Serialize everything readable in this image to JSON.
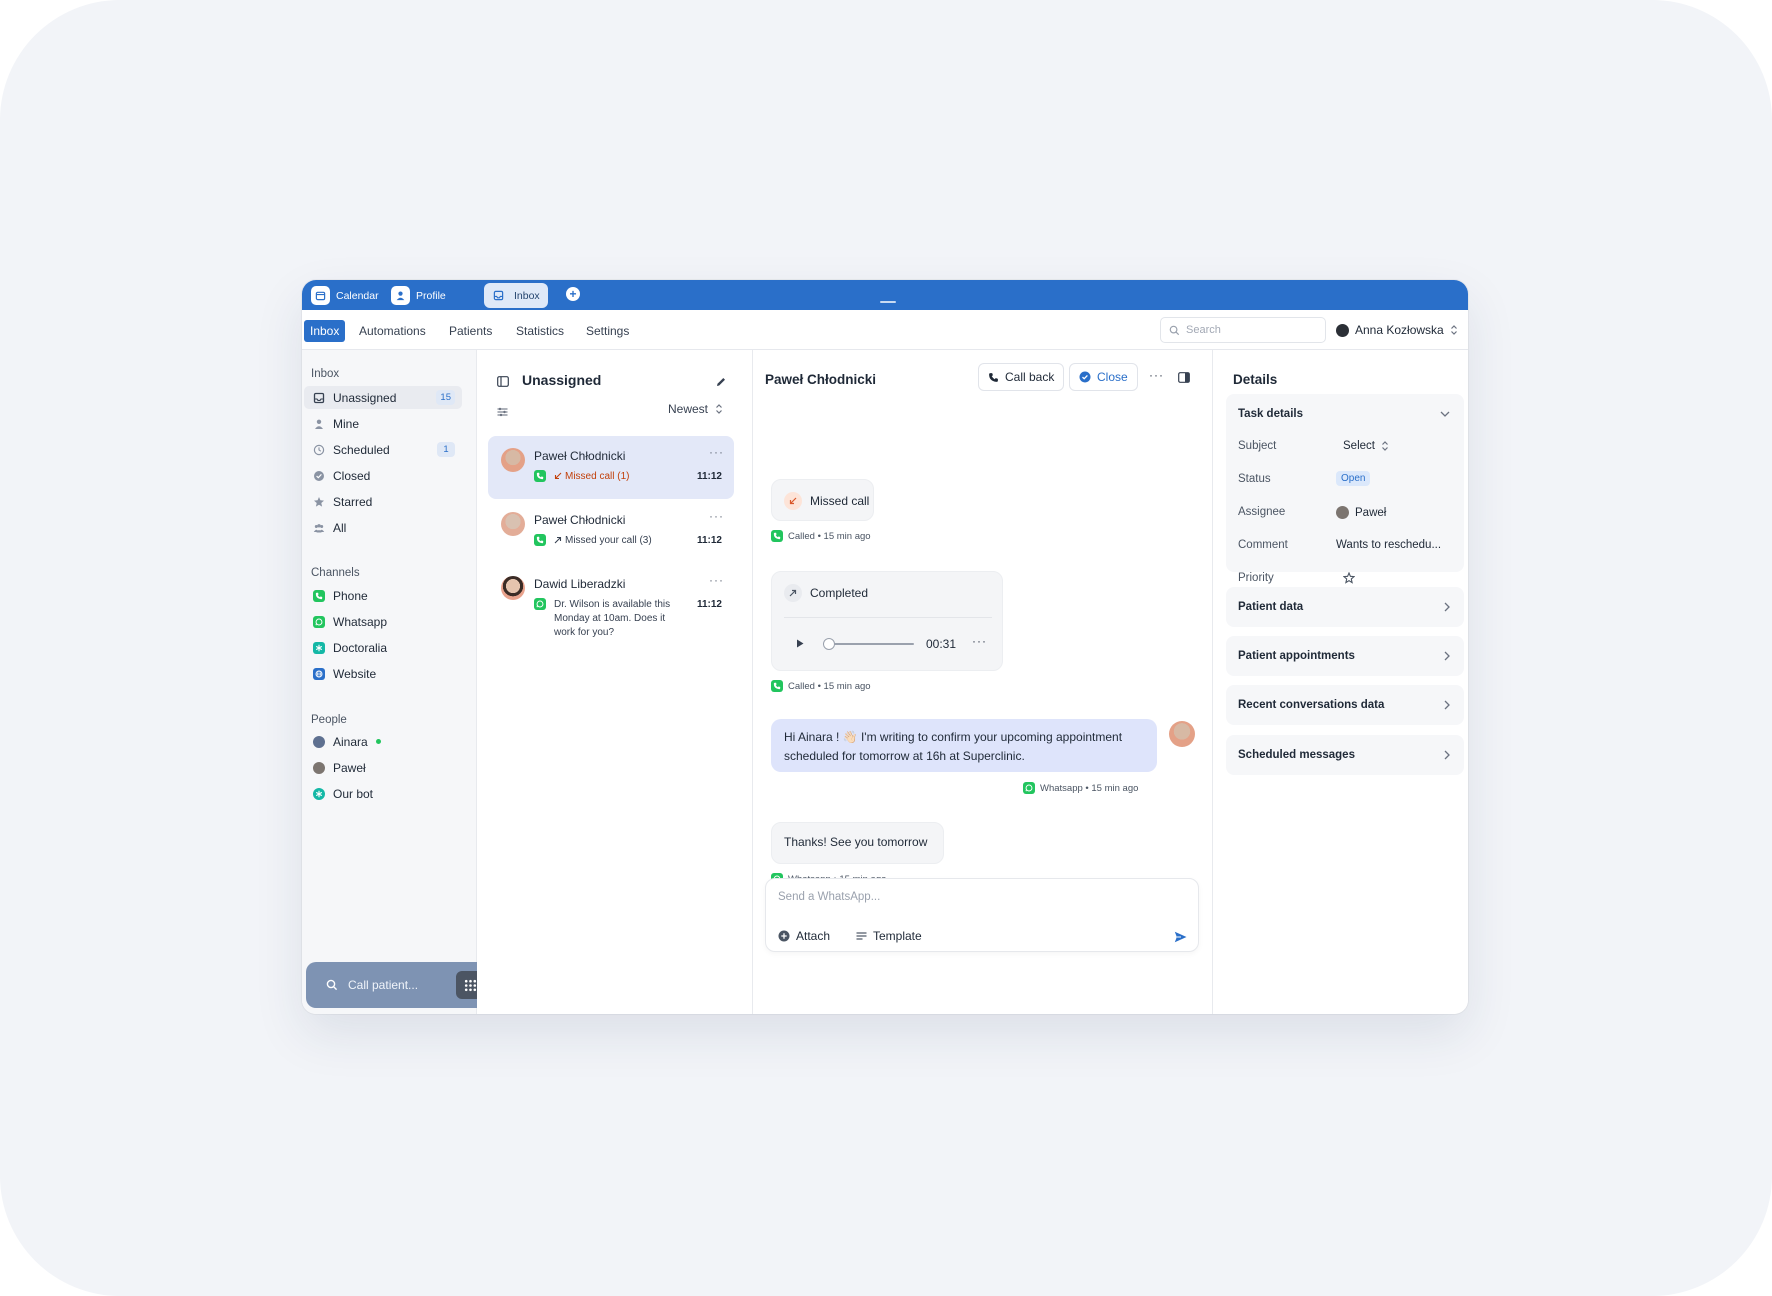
{
  "window_tabs": [
    {
      "label": "Calendar",
      "icon": "calendar-icon"
    },
    {
      "label": "Profile",
      "icon": "profile-icon"
    },
    {
      "label": "Inbox",
      "icon": "inbox-icon",
      "active": true
    }
  ],
  "nav": {
    "items": [
      "Inbox",
      "Automations",
      "Patients",
      "Statistics",
      "Settings"
    ],
    "active": "Inbox",
    "search_placeholder": "Search",
    "user_name": "Anna Kozłowska"
  },
  "sidebar": {
    "inbox_heading": "Inbox",
    "inbox_items": [
      {
        "label": "Unassigned",
        "count": "15",
        "icon": "inbox-tray-icon"
      },
      {
        "label": "Mine",
        "icon": "person-icon"
      },
      {
        "label": "Scheduled",
        "count": "1",
        "icon": "clock-icon"
      },
      {
        "label": "Closed",
        "icon": "check-circle-icon"
      },
      {
        "label": "Starred",
        "icon": "star-icon"
      },
      {
        "label": "All",
        "icon": "people-icon"
      }
    ],
    "channels_heading": "Channels",
    "channels": [
      {
        "label": "Phone",
        "color": "#22c55e"
      },
      {
        "label": "Whatsapp",
        "color": "#22c55e"
      },
      {
        "label": "Doctoralia",
        "color": "#14b8a6"
      },
      {
        "label": "Website",
        "color": "#2a6fc9"
      }
    ],
    "people_heading": "People",
    "people": [
      {
        "label": "Ainara",
        "online": true
      },
      {
        "label": "Paweł"
      },
      {
        "label": "Our bot"
      }
    ],
    "call_placeholder": "Call patient..."
  },
  "list": {
    "title": "Unassigned",
    "sort": "Newest",
    "conversations": [
      {
        "name": "Paweł Chłodnicki",
        "preview": "Missed call (1)",
        "time": "11:12"
      },
      {
        "name": "Paweł Chłodnicki",
        "preview": "Missed your call (3)",
        "time": "11:12"
      },
      {
        "name": "Dawid Liberadzki",
        "preview": "Dr. Wilson is available this Monday at 10am. Does it work for you?",
        "time": "11:12"
      }
    ]
  },
  "chat": {
    "title": "Paweł Chłodnicki",
    "call_back": "Call back",
    "close": "Close",
    "missed_call": "Missed call",
    "missed_meta": "Called • 15 min ago",
    "completed": "Completed",
    "duration": "00:31",
    "completed_meta": "Called • 15 min ago",
    "outgoing": "Hi Ainara ! 👋🏻 I'm writing to confirm your upcoming appointment scheduled for tomorrow at 16h at Superclinic.",
    "outgoing_meta": "Whatsapp • 15 min ago",
    "incoming": "Thanks! See you tomorrow",
    "incoming_meta": "Whatsapp • 15 min ago",
    "composer_placeholder": "Send a WhatsApp...",
    "attach": "Attach",
    "template": "Template"
  },
  "details": {
    "title": "Details",
    "task_details": "Task details",
    "fields": {
      "subject_label": "Subject",
      "subject_value": "Select",
      "status_label": "Status",
      "status_value": "Open",
      "assignee_label": "Assignee",
      "assignee_value": "Paweł",
      "comment_label": "Comment",
      "comment_value": "Wants to reschedu...",
      "priority_label": "Priority"
    },
    "sections": [
      "Patient data",
      "Patient appointments",
      "Recent conversations data",
      "Scheduled messages"
    ]
  },
  "colors": {
    "accent": "#2a6fc9",
    "whatsapp": "#22c55e",
    "selected_conversation": "#e3e8f8"
  }
}
